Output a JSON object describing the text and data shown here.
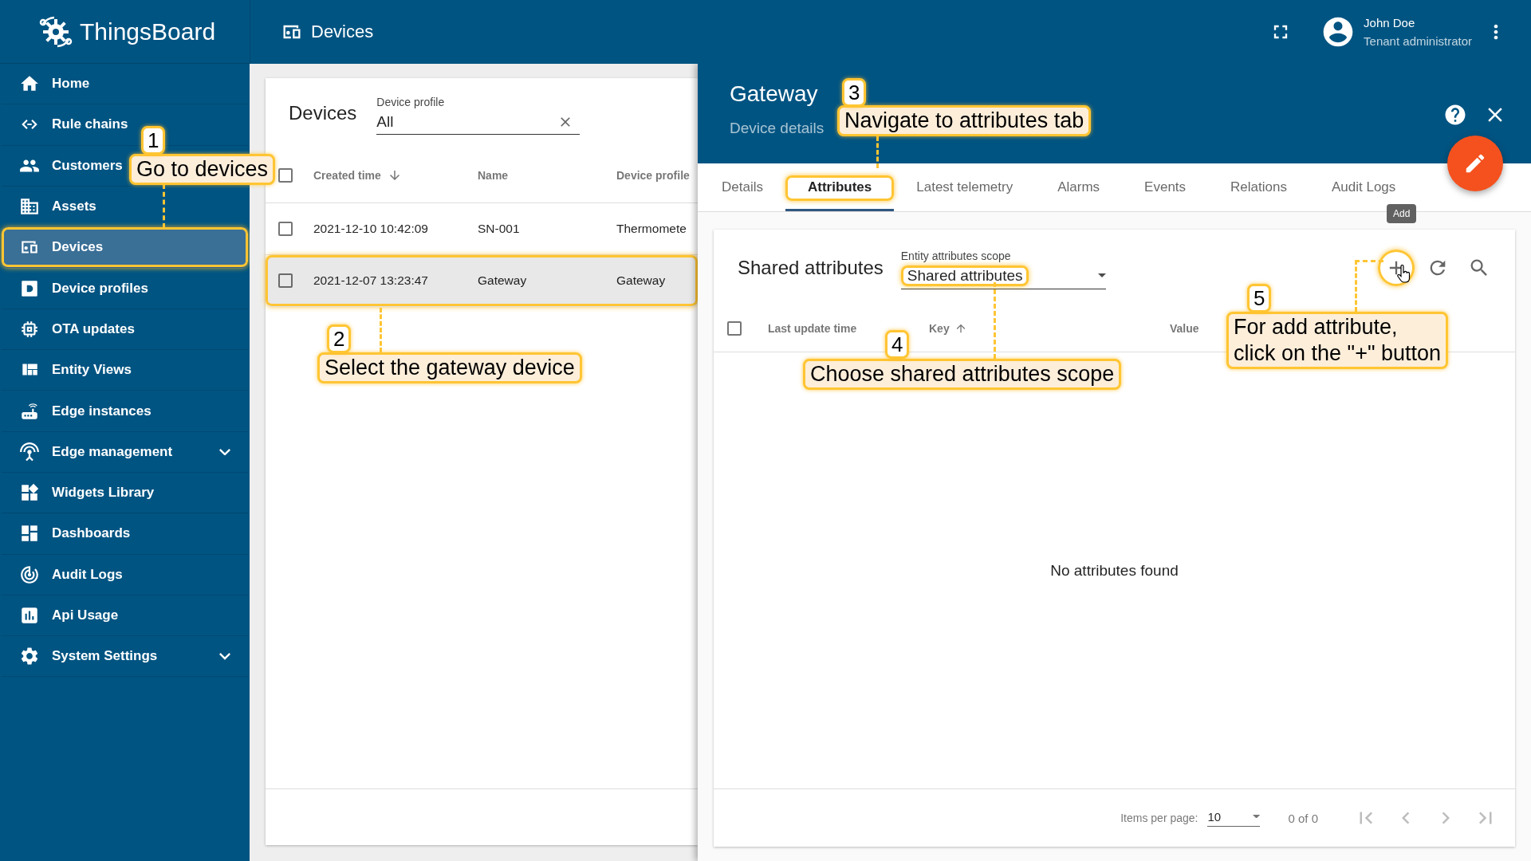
{
  "topbar": {
    "logo": "ThingsBoard",
    "title": "Devices",
    "user_name": "John Doe",
    "user_role": "Tenant administrator"
  },
  "sidebar": {
    "items": [
      {
        "label": "Home",
        "selected": false,
        "outlined": false,
        "expandable": false
      },
      {
        "label": "Rule chains",
        "selected": false,
        "outlined": false,
        "expandable": false
      },
      {
        "label": "Customers",
        "selected": false,
        "outlined": false,
        "expandable": false
      },
      {
        "label": "Assets",
        "selected": false,
        "outlined": false,
        "expandable": false
      },
      {
        "label": "Devices",
        "selected": true,
        "outlined": true,
        "expandable": false
      },
      {
        "label": "Device profiles",
        "selected": false,
        "outlined": false,
        "expandable": false
      },
      {
        "label": "OTA updates",
        "selected": false,
        "outlined": false,
        "expandable": false
      },
      {
        "label": "Entity Views",
        "selected": false,
        "outlined": false,
        "expandable": false
      },
      {
        "label": "Edge instances",
        "selected": false,
        "outlined": false,
        "expandable": false
      },
      {
        "label": "Edge management",
        "selected": false,
        "outlined": false,
        "expandable": true
      },
      {
        "label": "Widgets Library",
        "selected": false,
        "outlined": false,
        "expandable": false
      },
      {
        "label": "Dashboards",
        "selected": false,
        "outlined": false,
        "expandable": false
      },
      {
        "label": "Audit Logs",
        "selected": false,
        "outlined": false,
        "expandable": false
      },
      {
        "label": "Api Usage",
        "selected": false,
        "outlined": false,
        "expandable": false
      },
      {
        "label": "System Settings",
        "selected": false,
        "outlined": false,
        "expandable": true
      }
    ]
  },
  "devices": {
    "title": "Devices",
    "filter": {
      "label": "Device profile",
      "value": "All"
    },
    "all_checked": false,
    "columns": [
      {
        "label": "Created time",
        "sorted": true,
        "descending": true
      },
      {
        "label": "Name",
        "sorted": false
      },
      {
        "label": "Device profile",
        "sorted": false
      }
    ],
    "rows": [
      {
        "cells": [
          "2021-12-10 10:42:09",
          "SN-001",
          "Thermomete"
        ],
        "checked": false,
        "selected": false,
        "outlined": false
      },
      {
        "cells": [
          "2021-12-07 13:23:47",
          "Gateway",
          "Gateway"
        ],
        "checked": false,
        "selected": true,
        "outlined": true
      }
    ]
  },
  "details": {
    "title": "Gateway",
    "subtitle": "Device details",
    "tabs": [
      {
        "label": "Details",
        "selected": false,
        "outlined": false
      },
      {
        "label": "Attributes",
        "selected": true,
        "outlined": true
      },
      {
        "label": "Latest telemetry",
        "selected": false,
        "outlined": false
      },
      {
        "label": "Alarms",
        "selected": false,
        "outlined": false
      },
      {
        "label": "Events",
        "selected": false,
        "outlined": false
      },
      {
        "label": "Relations",
        "selected": false,
        "outlined": false
      },
      {
        "label": "Audit Logs",
        "selected": false,
        "outlined": false
      }
    ],
    "tooltip": "Add",
    "attributes": {
      "title": "Shared attributes",
      "scope": {
        "label": "Entity attributes scope",
        "value": "Shared attributes",
        "outlined": true
      },
      "add_outlined": true,
      "all_checked": false,
      "columns": [
        {
          "label": "Last update time",
          "sorted": false
        },
        {
          "label": "Key",
          "sorted": true,
          "descending": false
        },
        {
          "label": "Value",
          "sorted": false
        }
      ],
      "empty": "No attributes found",
      "pager": {
        "label": "Items per page:",
        "page_size": "10",
        "range": "0 of 0",
        "nav_disabled": true
      }
    }
  },
  "callouts": [
    {
      "number": "1",
      "text": "Go to devices"
    },
    {
      "number": "2",
      "text": "Select the gateway device"
    },
    {
      "number": "3",
      "text": "Navigate to attributes tab"
    },
    {
      "number": "4",
      "text": "Choose shared attributes scope"
    },
    {
      "number": "5",
      "text": "For add attribute,\nclick on the \"+\" button"
    }
  ]
}
